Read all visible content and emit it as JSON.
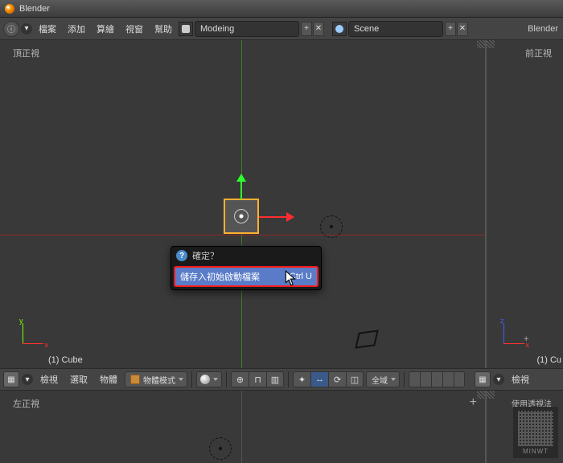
{
  "window": {
    "title": "Blender"
  },
  "topmenu": {
    "items": [
      "檔案",
      "添加",
      "算繪",
      "視窗",
      "幫助"
    ],
    "layout_input": "Modeing",
    "scene_input": "Scene",
    "right_label": "Blender"
  },
  "viewports": {
    "top_left_label": "頂正視",
    "top_right_label": "前正視",
    "object_label_left": "(1) Cube",
    "object_label_right": "(1) Cu",
    "axis_left": {
      "v": "y",
      "h": "x"
    },
    "axis_right": {
      "v": "z",
      "h": "x"
    },
    "bottom_left_label": "左正視",
    "bottom_right_label": "使用透視法"
  },
  "popup": {
    "title": "確定？",
    "item_label": "儲存入初始啟動檔案",
    "item_shortcut": "Ctrl U"
  },
  "toolbar": {
    "menu": [
      "檢視",
      "選取",
      "物體"
    ],
    "mode": "物體模式",
    "orientation": "全域",
    "right_view": "檢視"
  },
  "watermark": "MINWT"
}
